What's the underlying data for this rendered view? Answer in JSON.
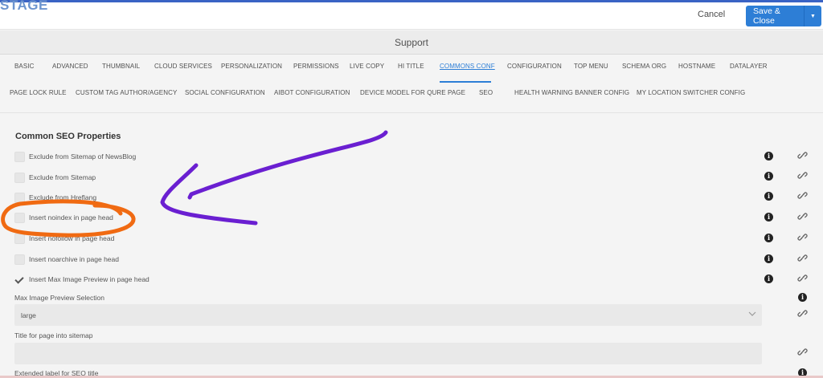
{
  "header": {
    "brand": "STAGE",
    "cancel_label": "Cancel",
    "save_label": "Save & Close",
    "save_menu_icon": "chevron-down-icon",
    "accent_color": "#2d7ed6"
  },
  "dialog": {
    "title": "Support"
  },
  "tabs": {
    "row1": [
      "BASIC",
      "ADVANCED",
      "THUMBNAIL",
      "CLOUD SERVICES",
      "PERSONALIZATION",
      "PERMISSIONS",
      "LIVE COPY",
      "HI TITLE",
      "COMMONS CONF",
      "CONFIGURATION",
      "TOP MENU",
      "SCHEMA ORG",
      "HOSTNAME",
      "DATALAYER"
    ],
    "row2": [
      "PAGE LOCK RULE",
      "CUSTOM TAG AUTHOR/AGENCY",
      "SOCIAL CONFIGURATION",
      "AIBOT CONFIGURATION",
      "DEVICE MODEL FOR QURE PAGE",
      "SEO",
      "HEALTH WARNING BANNER CONFIG",
      "MY LOCATION SWITCHER CONFIG"
    ],
    "active": "COMMONS CONF"
  },
  "section": {
    "title": "Common SEO Properties",
    "checkboxes": [
      {
        "label": "Exclude from Sitemap of NewsBlog",
        "checked": false
      },
      {
        "label": "Exclude from Sitemap",
        "checked": false
      },
      {
        "label": "Exclude from Hreflang",
        "checked": false
      },
      {
        "label": "Insert noindex in page head",
        "checked": false
      },
      {
        "label": "Insert nofollow in page head",
        "checked": false
      },
      {
        "label": "Insert noarchive in page head",
        "checked": false
      },
      {
        "label": "Insert Max Image Preview in page head",
        "checked": true
      }
    ],
    "max_image_preview": {
      "label": "Max Image Preview Selection",
      "value": "large"
    },
    "sitemap_title": {
      "label": "Title for page into sitemap",
      "value": ""
    },
    "extended_label": {
      "label": "Extended label for SEO title"
    },
    "info_icon": "info-icon",
    "link_icon": "link-icon"
  },
  "annotations": {
    "arrow_color": "#6a1fd1",
    "circle_color": "#f06a12"
  }
}
